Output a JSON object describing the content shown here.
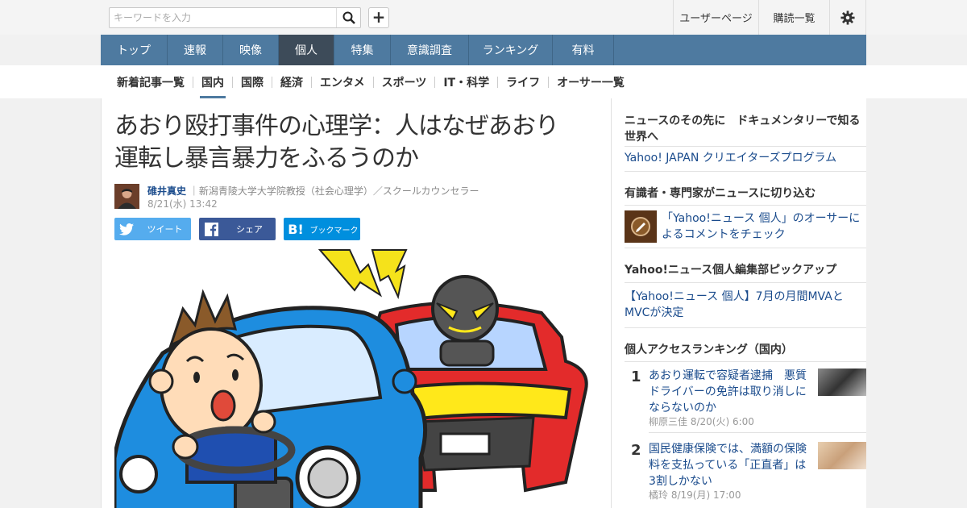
{
  "header": {
    "search_placeholder": "キーワードを入力",
    "user_page": "ユーザーページ",
    "subscriptions": "購読一覧"
  },
  "nav": {
    "items": [
      "トップ",
      "速報",
      "映像",
      "個人",
      "特集",
      "意識調査",
      "ランキング",
      "有料"
    ],
    "active": "個人"
  },
  "subnav": {
    "items": [
      "新着記事一覧",
      "国内",
      "国際",
      "経済",
      "エンタメ",
      "スポーツ",
      "IT・科学",
      "ライフ",
      "オーサー一覧"
    ],
    "active": "国内"
  },
  "article": {
    "title_line1": "あおり殴打事件の心理学：人はなぜあおり",
    "title_line2": "運転し暴言暴力をふるうのか",
    "author_name": "碓井真史",
    "author_role": "｜新潟青陵大学大学院教授（社会心理学）／スクールカウンセラー",
    "date": "8/21(水) 13:42",
    "share": {
      "tweet": "ツイート",
      "share": "シェア",
      "bookmark": "ブックマーク"
    }
  },
  "sidebar": {
    "section1_title": "ニュースのその先に　ドキュメンタリーで知る世界へ",
    "section1_link": "Yahoo! JAPAN クリエイターズプログラム",
    "section2_title": "有識者・専門家がニュースに切り込む",
    "section2_link": "「Yahoo!ニュース 個人」のオーサーによるコメントをチェック",
    "section3_title": "Yahoo!ニュース個人編集部ピックアップ",
    "section3_link": "【Yahoo!ニュース 個人】7月の月間MVAとMVCが決定",
    "ranking_title": "個人アクセスランキング（国内）",
    "ranking": [
      {
        "rank": "1",
        "title": "あおり運転で容疑者逮捕　悪質ドライバーの免許は取り消しにならないのか",
        "meta": "柳原三佳  8/20(火) 6:00"
      },
      {
        "rank": "2",
        "title": "国民健康保険では、満額の保険料を支払っている「正直者」は3割しかない",
        "meta": "橘玲  8/19(月) 17:00"
      }
    ]
  },
  "colors": {
    "nav": "#4e7aa0",
    "nav_active": "#3d4b59",
    "link": "#1a4b8c",
    "twitter": "#55acee",
    "facebook": "#3b5998",
    "hatena": "#008fde"
  }
}
